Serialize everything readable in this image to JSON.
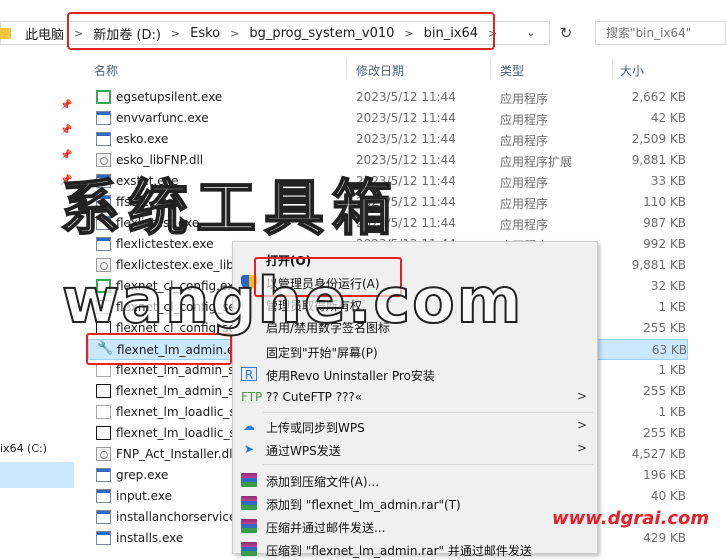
{
  "breadcrumb": {
    "items": [
      "此电脑",
      "新加卷 (D:)",
      "Esko",
      "bg_prog_system_v010",
      "bin_ix64"
    ]
  },
  "search": {
    "placeholder": "搜索\"bin_ix64\""
  },
  "columns": {
    "name": "名称",
    "date": "修改日期",
    "type": "类型",
    "size": "大小"
  },
  "nav": {
    "drive": "ix64 (C:)"
  },
  "files": [
    {
      "name": "egsetupsilent.exe",
      "date": "2023/5/12 11:44",
      "type": "应用程序",
      "size": "2,662 KB",
      "icon": "green-exe-icon"
    },
    {
      "name": "envvarfunc.exe",
      "date": "2023/5/12 11:44",
      "type": "应用程序",
      "size": "42 KB",
      "icon": "exe-icon"
    },
    {
      "name": "esko.exe",
      "date": "2023/5/12 11:44",
      "type": "应用程序",
      "size": "2,509 KB",
      "icon": "exe-icon"
    },
    {
      "name": "esko_libFNP.dll",
      "date": "2023/5/12 11:44",
      "type": "应用程序扩展",
      "size": "9,881 KB",
      "icon": "dll-icon"
    },
    {
      "name": "exstat.exe",
      "date": "2023/5/12 11:44",
      "type": "应用程序",
      "size": "33 KB",
      "icon": "exe-icon"
    },
    {
      "name": "ffsefc.exe",
      "date": "2023/5/12 11:44",
      "type": "应用程序",
      "size": "110 KB",
      "icon": "exe-icon"
    },
    {
      "name": "flexlictest.exe",
      "date": "2023/5/12 11:44",
      "type": "应用程序",
      "size": "987 KB",
      "icon": "exe-icon"
    },
    {
      "name": "flexlictestex.exe",
      "date": "2023/5/12 11:44",
      "type": "应用程序",
      "size": "992 KB",
      "icon": "exe-icon"
    },
    {
      "name": "flexlictestex.exe_libFNP.dll",
      "date": "",
      "type": "",
      "size": "9,881 KB",
      "icon": "dll-icon"
    },
    {
      "name": "flexnet_cl_config.exe",
      "date": "",
      "type": "",
      "size": "32 KB",
      "icon": "green-exe-icon"
    },
    {
      "name": "flexnet_cl_config_setup.exe",
      "date": "",
      "type": "",
      "size": "1 KB",
      "icon": "blank-icon"
    },
    {
      "name": "flexnet_cl_config_setup2.exe",
      "date": "",
      "type": "",
      "size": "255 KB",
      "icon": "black-icon"
    },
    {
      "name": "flexnet_lm_admin.exe",
      "date": "",
      "type": "",
      "size": "63 KB",
      "icon": "wrench-icon",
      "selected": true
    },
    {
      "name": "flexnet_lm_admin_setup.exe",
      "date": "",
      "type": "",
      "size": "1 KB",
      "icon": "blank-icon"
    },
    {
      "name": "flexnet_lm_admin_setup2.exe",
      "date": "",
      "type": "",
      "size": "255 KB",
      "icon": "black-icon"
    },
    {
      "name": "flexnet_lm_loadlic_setup.exe",
      "date": "",
      "type": "",
      "size": "1 KB",
      "icon": "blank-icon"
    },
    {
      "name": "flexnet_lm_loadlic_setup2.exe",
      "date": "",
      "type": "",
      "size": "255 KB",
      "icon": "black-icon"
    },
    {
      "name": "FNP_Act_Installer.dll",
      "date": "",
      "type": "",
      "size": "4,527 KB",
      "icon": "dll-icon"
    },
    {
      "name": "grep.exe",
      "date": "",
      "type": "",
      "size": "196 KB",
      "icon": "exe-icon"
    },
    {
      "name": "input.exe",
      "date": "",
      "type": "",
      "size": "40 KB",
      "icon": "exe-icon"
    },
    {
      "name": "installanchorservice.exe",
      "date": "",
      "type": "",
      "size": "",
      "icon": "exe-icon"
    },
    {
      "name": "installs.exe",
      "date": "",
      "type": "",
      "size": "429 KB",
      "icon": "exe-icon"
    }
  ],
  "context_menu": {
    "items": [
      {
        "label": "打开(O)",
        "bold": true,
        "icon": ""
      },
      {
        "label": "以管理员身份运行(A)",
        "icon": "shield-icon"
      },
      {
        "label": "管理员取得所有权",
        "icon": ""
      },
      {
        "label": "启用/禁用数字签名图标",
        "icon": ""
      },
      {
        "label": "固定到\"开始\"屏幕(P)",
        "icon": ""
      },
      {
        "label": "使用Revo Uninstaller Pro安装",
        "icon": "revo-icon"
      },
      {
        "label": "?? CuteFTP ???«",
        "icon": "cuteftp-icon",
        "submenu": true
      },
      {
        "label": "上传或同步到WPS",
        "icon": "cloud-icon",
        "submenu": true
      },
      {
        "label": "通过WPS发送",
        "icon": "wps-send-icon",
        "submenu": true
      },
      {
        "label": "添加到压缩文件(A)...",
        "icon": "winrar-icon"
      },
      {
        "label": "添加到 \"flexnet_lm_admin.rar\"(T)",
        "icon": "winrar-icon"
      },
      {
        "label": "压缩并通过邮件发送...",
        "icon": "winrar-icon"
      },
      {
        "label": "压缩到 \"flexnet_lm_admin.rar\" 并通过邮件发送",
        "icon": "winrar-icon"
      }
    ]
  },
  "watermarks": {
    "w1": "系统工具箱",
    "w2": "wanghe.com",
    "w3": "www.dgrai.com"
  }
}
